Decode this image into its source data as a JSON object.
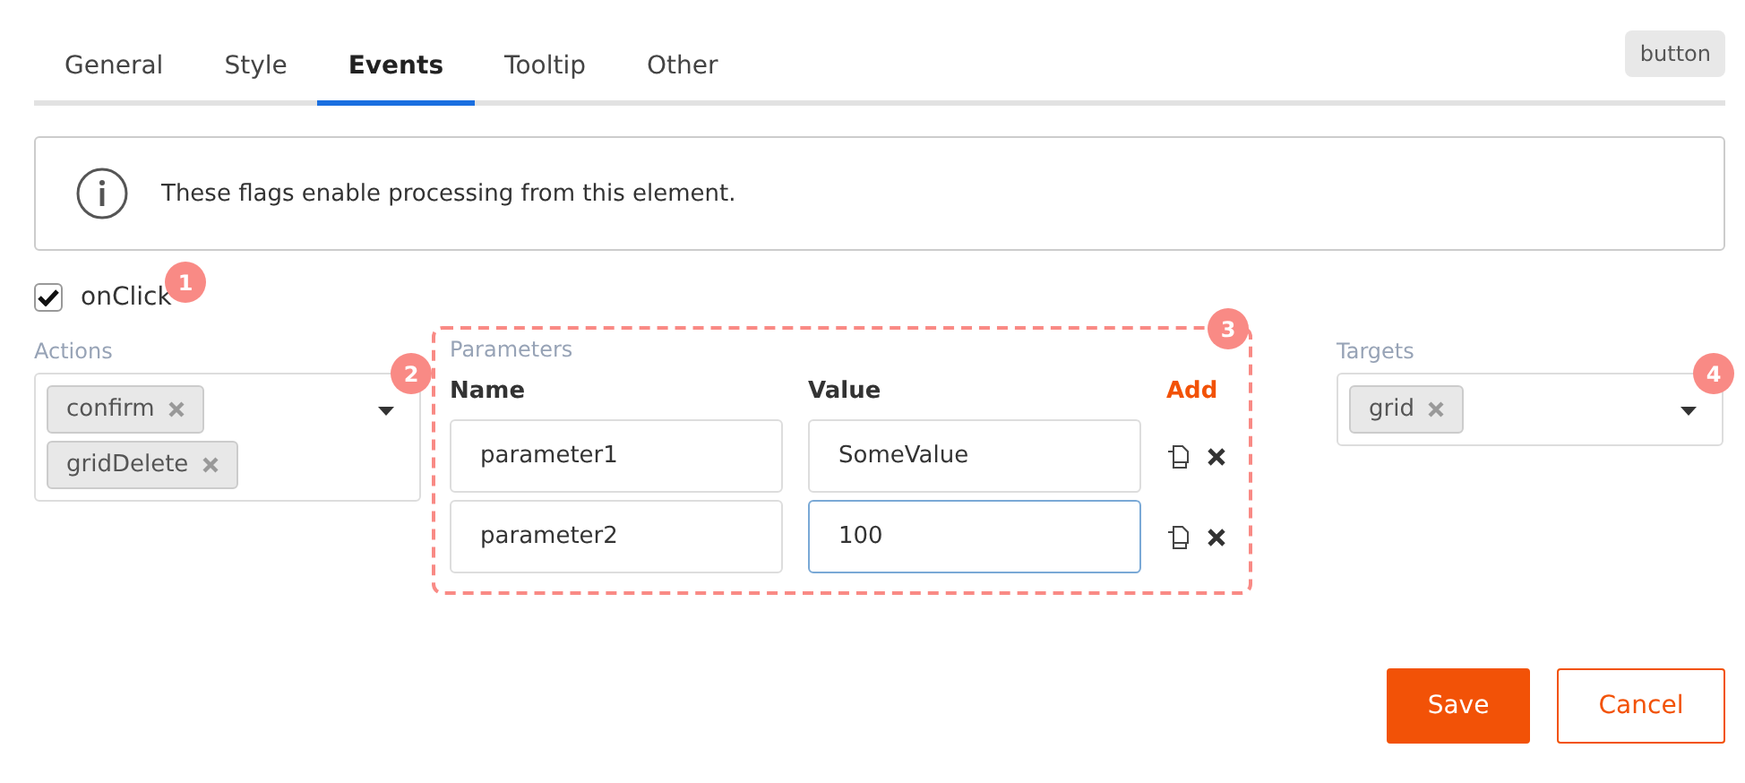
{
  "tabs": [
    {
      "label": "General",
      "selected": false
    },
    {
      "label": "Style",
      "selected": false
    },
    {
      "label": "Events",
      "selected": true
    },
    {
      "label": "Tooltip",
      "selected": false
    },
    {
      "label": "Other",
      "selected": false
    }
  ],
  "type_badge": "button",
  "info": {
    "text": "These flags enable processing from this element."
  },
  "onclick": {
    "label": "onClick",
    "checked": true,
    "marker": "1"
  },
  "actions": {
    "label": "Actions",
    "marker": "2",
    "tags": [
      "confirm",
      "gridDelete"
    ]
  },
  "parameters": {
    "label": "Parameters",
    "marker": "3",
    "name_header": "Name",
    "value_header": "Value",
    "add": "Add",
    "rows": [
      {
        "name": "parameter1",
        "value": "SomeValue",
        "focused": false
      },
      {
        "name": "parameter2",
        "value": "100",
        "focused": true
      }
    ]
  },
  "targets": {
    "label": "Targets",
    "marker": "4",
    "tags": [
      "grid"
    ]
  },
  "buttons": [
    {
      "label": "Save",
      "kind": "primary"
    },
    {
      "label": "Cancel",
      "kind": "secondary"
    }
  ]
}
